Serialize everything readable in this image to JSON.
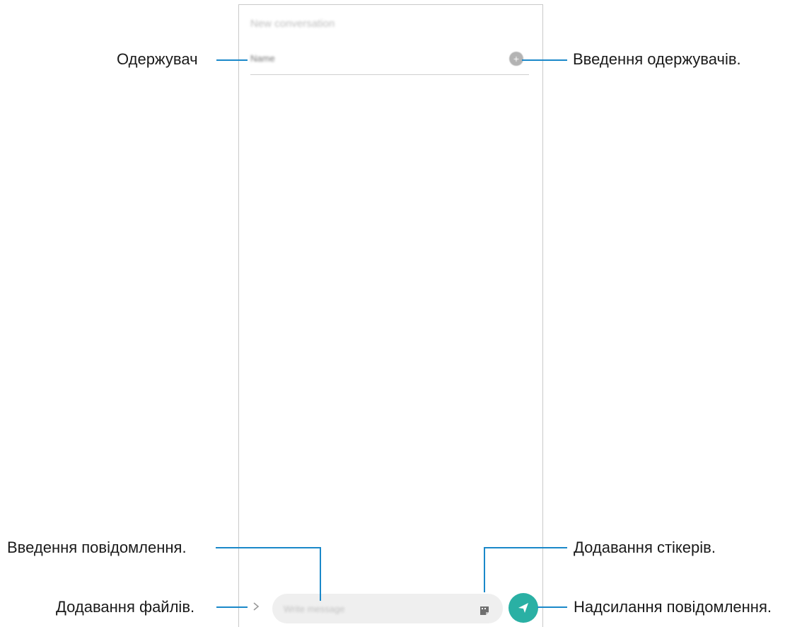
{
  "screen": {
    "title": "New conversation",
    "recipient_placeholder": "Name",
    "message_placeholder": "Write message"
  },
  "callouts": {
    "recipient": "Одержувач",
    "enter_recipients": "Введення одержувачів.",
    "enter_message": "Введення повідомлення.",
    "add_stickers": "Додавання стікерів.",
    "attach_files": "Додавання файлів.",
    "send_message": "Надсилання повідомлення."
  },
  "icons": {
    "add_recipient": "plus-circle-icon",
    "attach": "chevron-right-icon",
    "sticker": "sticker-icon",
    "send": "send-arrow-icon"
  },
  "colors": {
    "callout_line": "#1a88c9",
    "send_button": "#2ab0a4"
  }
}
